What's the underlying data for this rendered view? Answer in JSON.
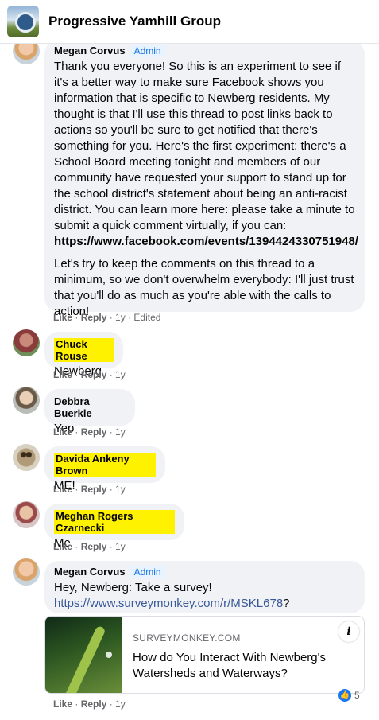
{
  "header": {
    "title": "Progressive Yamhill Group"
  },
  "action_labels": {
    "like": "Like",
    "reply": "Reply"
  },
  "comments": [
    {
      "author": "Megan Corvus",
      "badge": "Admin",
      "paragraph1": "Thank you everyone! So this is an experiment to see if it's a better way to make sure Facebook shows you information that is specific to Newberg residents. My thought is that I'll use this thread to post links back to actions so you'll be sure to get notified that there's something for you. Here's the first experiment: there's a School Board meeting tonight and members of our community have requested your support to stand up for the school district's statement about being an anti-racist district. You can learn more here: please take a minute to submit a quick comment virtually, if you can:",
      "link": "https://www.facebook.com/events/1394424330751948/",
      "paragraph2": "Let's try to keep the comments on this thread to a minimum, so we don't overwhelm everybody: I'll just trust that you'll do as much as you're able with the calls to action!",
      "time": "1y",
      "edited": "Edited"
    },
    {
      "author": "Chuck Rouse",
      "text": "Newberg",
      "time": "1y"
    },
    {
      "author": "Debbra Buerkle",
      "text": "Yep",
      "time": "1y"
    },
    {
      "author": "Davida Ankeny Brown",
      "text": "ME!",
      "time": "1y"
    },
    {
      "author": "Meghan Rogers Czarnecki",
      "text": "Me",
      "time": "1y"
    },
    {
      "author": "Megan Corvus",
      "badge": "Admin",
      "text": "Hey, Newberg: Take a survey!",
      "link": "https://www.surveymonkey.com/r/MSKL678",
      "link_suffix": "?",
      "time": "1y",
      "preview": {
        "domain": "SURVEYMONKEY.COM",
        "title": "How do You Interact With Newberg's Watersheds and Waterways?",
        "info": "i"
      },
      "reaction_count": "5"
    }
  ]
}
